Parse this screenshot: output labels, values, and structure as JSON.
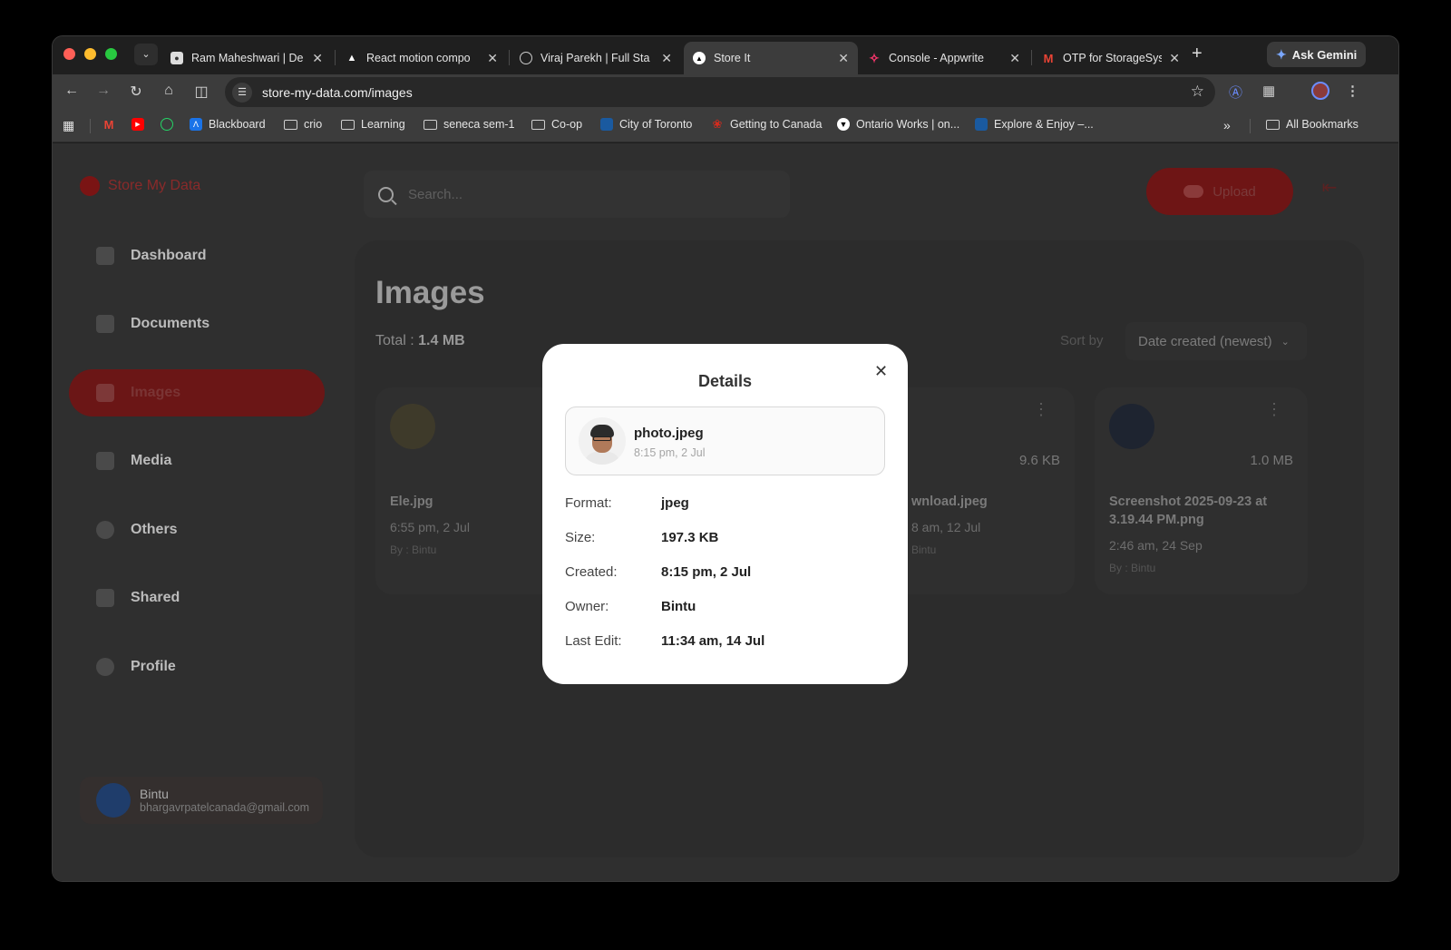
{
  "browser": {
    "tabs": [
      {
        "title": "Ram Maheshwari | De",
        "favicon": "person-icon",
        "color": "#ffffff",
        "active": false
      },
      {
        "title": "React motion compo",
        "favicon": "motion-icon",
        "color": "#ffffff",
        "active": false
      },
      {
        "title": "Viraj Parekh | Full Sta",
        "favicon": "globe-icon",
        "color": "#cccccc",
        "active": false
      },
      {
        "title": "Store It",
        "favicon": "triangle-icon",
        "color": "#ffffff",
        "active": true
      },
      {
        "title": "Console - Appwrite",
        "favicon": "appwrite-icon",
        "color": "#fd366e",
        "active": false
      },
      {
        "title": "OTP for StorageSyst",
        "favicon": "gmail-icon",
        "color": "#ea4335",
        "active": false
      }
    ],
    "ask_gemini": "Ask Gemini",
    "url": "store-my-data.com/images",
    "bookmarks": [
      {
        "label": "",
        "icon": "gmail-icon",
        "color": "#ea4335"
      },
      {
        "label": "",
        "icon": "youtube-icon",
        "color": "#ff0000"
      },
      {
        "label": "",
        "icon": "whatsapp-icon",
        "color": "#25d366"
      },
      {
        "label": "Blackboard",
        "icon": "blackboard-icon",
        "color": "#1a73e8"
      },
      {
        "label": "crio",
        "icon": "folder-icon"
      },
      {
        "label": "Learning",
        "icon": "folder-icon"
      },
      {
        "label": "seneca sem-1",
        "icon": "folder-icon"
      },
      {
        "label": "Co-op",
        "icon": "folder-icon"
      },
      {
        "label": "City of Toronto",
        "icon": "toronto-icon",
        "color": "#1a5aa0"
      },
      {
        "label": "Getting to Canada",
        "icon": "maple-leaf-icon",
        "color": "#d52b1e"
      },
      {
        "label": "Ontario Works | on...",
        "icon": "ontario-icon",
        "color": "#ffffff"
      },
      {
        "label": "Explore & Enjoy –...",
        "icon": "explore-icon",
        "color": "#1a5aa0"
      }
    ],
    "all_bookmarks": "All Bookmarks"
  },
  "app": {
    "brand": "Store My Data",
    "search_placeholder": "Search...",
    "upload_label": "Upload",
    "nav": [
      {
        "label": "Dashboard",
        "active": false
      },
      {
        "label": "Documents",
        "active": false
      },
      {
        "label": "Images",
        "active": true
      },
      {
        "label": "Media",
        "active": false
      },
      {
        "label": "Others",
        "active": false
      },
      {
        "label": "Shared",
        "active": false
      },
      {
        "label": "Profile",
        "active": false
      }
    ],
    "user": {
      "name": "Bintu",
      "email": "bhargavrpatelcanada@gmail.com"
    },
    "page_title": "Images",
    "total_label": "Total :",
    "total_value": "1.4 MB",
    "sort_label": "Sort by",
    "sort_value": "Date created (newest)",
    "cards": [
      {
        "name": "Ele.jpg",
        "size": "",
        "date": "6:55 pm, 2 Jul",
        "by": "By : Bintu"
      },
      {
        "name": "wnload.jpeg",
        "size": "9.6 KB",
        "date": "8 am, 12 Jul",
        "by": "Bintu"
      },
      {
        "name": "Screenshot 2025-09-23 at 3.19.44 PM.png",
        "size": "1.0 MB",
        "date": "2:46 am, 24 Sep",
        "by": "By : Bintu"
      }
    ]
  },
  "modal": {
    "title": "Details",
    "file_name": "photo.jpeg",
    "file_date": "8:15 pm, 2 Jul",
    "rows": [
      {
        "label": "Format:",
        "value": "jpeg"
      },
      {
        "label": "Size:",
        "value": "197.3 KB"
      },
      {
        "label": "Created:",
        "value": "8:15 pm, 2 Jul"
      },
      {
        "label": "Owner:",
        "value": "Bintu"
      },
      {
        "label": "Last Edit:",
        "value": "11:34 am, 14 Jul"
      }
    ]
  }
}
